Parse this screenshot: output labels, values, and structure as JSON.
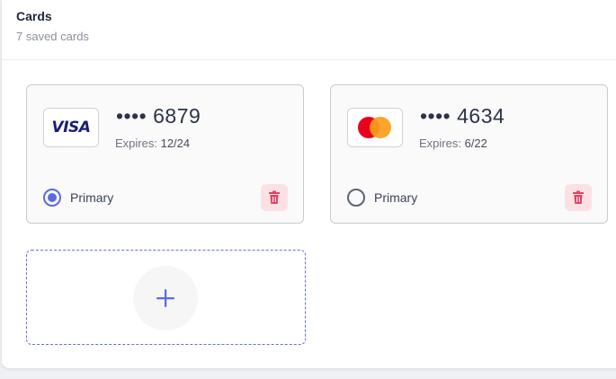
{
  "header": {
    "title": "Cards",
    "subtitle": "7 saved cards"
  },
  "cards": [
    {
      "brand": "visa",
      "brand_text": "VISA",
      "dots": "••••",
      "last4": "6879",
      "expires_label": "Expires:",
      "expires": "12/24",
      "primary_label": "Primary",
      "is_primary": true
    },
    {
      "brand": "mastercard",
      "dots": "••••",
      "last4": "4634",
      "expires_label": "Expires:",
      "expires": "6/22",
      "primary_label": "Primary",
      "is_primary": false
    }
  ],
  "icons": {
    "delete": "trash-icon",
    "add": "plus-icon",
    "brand_visa": "visa-logo",
    "brand_mastercard": "mastercard-logo"
  },
  "colors": {
    "accent": "#5a6ae0",
    "danger": "#e0435f",
    "danger_bg": "#fbe1e6",
    "visa_blue": "#1a1f71",
    "mc_red": "#eb001b",
    "mc_orange": "#f79e1b"
  }
}
